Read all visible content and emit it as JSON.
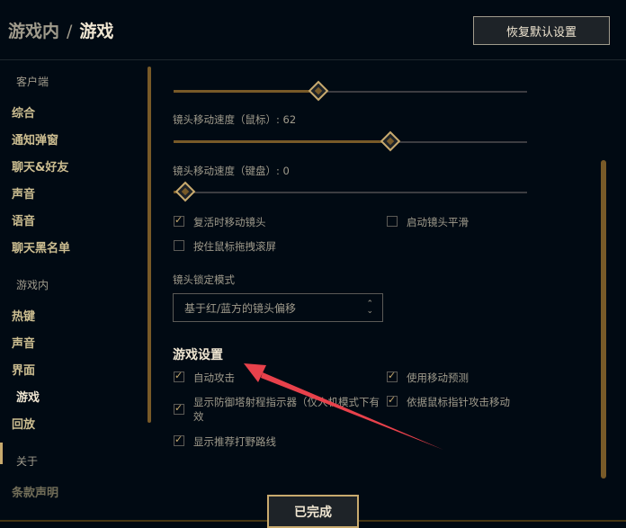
{
  "header": {
    "breadcrumb_parent": "游戏内",
    "breadcrumb_separator": "/",
    "breadcrumb_current": "游戏",
    "reset_label": "恢复默认设置"
  },
  "sidebar": {
    "section_client": "客户端",
    "client_items": [
      "综合",
      "通知弹窗",
      "聊天&好友",
      "声音",
      "语音",
      "聊天黑名单"
    ],
    "section_ingame": "游戏内",
    "ingame_items": [
      "热键",
      "声音",
      "界面",
      "游戏",
      "回放"
    ],
    "section_about": "关于",
    "about_items": [
      "条款声明"
    ],
    "active_item": "游戏"
  },
  "camera": {
    "slider_top_value_fraction": 0.41,
    "mouse_speed_label": "镜头移动速度（鼠标）: 62",
    "mouse_speed": 62,
    "keyboard_speed_label": "镜头移动速度（键盘）: 0",
    "keyboard_speed": 0,
    "options": [
      {
        "label": "复活时移动镜头",
        "checked": true
      },
      {
        "label": "启动镜头平滑",
        "checked": false
      },
      {
        "label": "按住鼠标拖拽滚屏",
        "checked": false
      }
    ],
    "lock_mode_label": "镜头锁定模式",
    "lock_mode_value": "基于红/蓝方的镜头偏移"
  },
  "game_settings": {
    "title": "游戏设置",
    "options": [
      {
        "label": "自动攻击",
        "checked": true
      },
      {
        "label": "使用移动预测",
        "checked": true
      },
      {
        "label": "显示防御塔射程指示器（仅人机模式下有效",
        "checked": true
      },
      {
        "label": "依据鼠标指针攻击移动",
        "checked": true
      },
      {
        "label": "显示推荐打野路线",
        "checked": true
      }
    ]
  },
  "footer": {
    "done_label": "已完成"
  },
  "colors": {
    "background": "#010a13",
    "gold": "#c8aa6e",
    "text_light": "#f0e6d2",
    "text_muted": "#a09b8c",
    "annotation_arrow": "#e8414b"
  }
}
